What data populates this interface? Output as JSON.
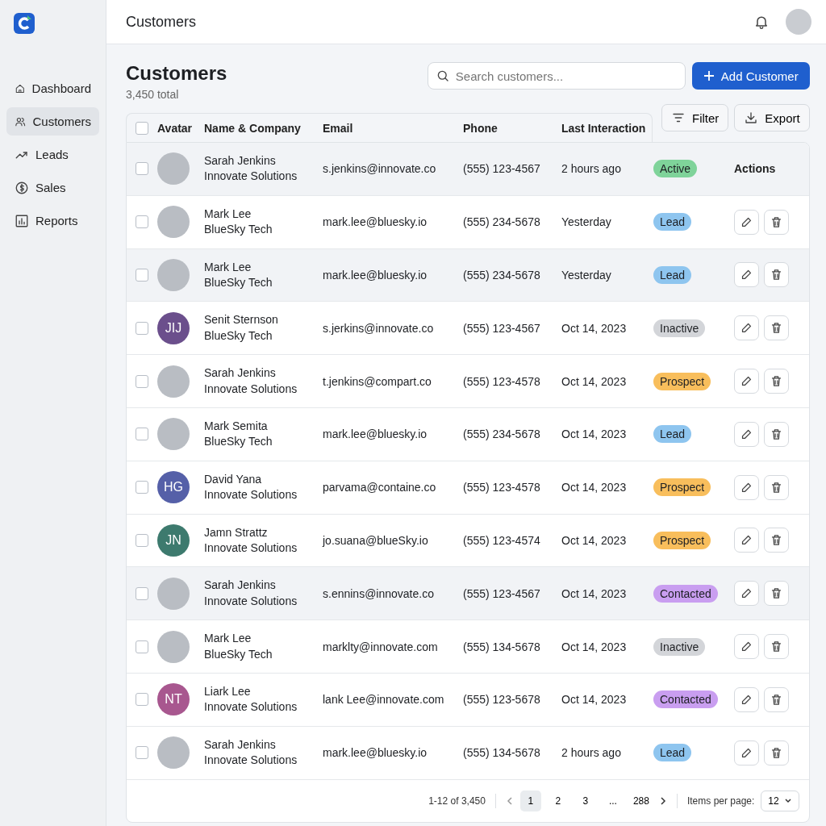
{
  "sidebar": {
    "items": [
      {
        "label": "Dashboard",
        "kind": "home",
        "selected": false
      },
      {
        "label": "Customers",
        "kind": "users",
        "selected": true
      },
      {
        "label": "Leads",
        "kind": "trend",
        "selected": false
      },
      {
        "label": "Sales",
        "kind": "dollar",
        "selected": false
      },
      {
        "label": "Reports",
        "kind": "chart",
        "selected": false
      }
    ]
  },
  "header": {
    "title": "Customers"
  },
  "page": {
    "title": "Customers",
    "subtitle": "3,450 total"
  },
  "search": {
    "placeholder": "Search customers..."
  },
  "add_button": "Add Customer",
  "filter_button": "Filter",
  "export_button": "Export",
  "table": {
    "select_all_checked": false,
    "columns": [
      "Avatar",
      "Name & Company",
      "Email",
      "Phone",
      "Last Interaction"
    ],
    "rows": [
      {
        "avatar": {
          "kind": "photo"
        },
        "name": "Sarah Jenkins",
        "company": "Innovate Solutions",
        "email": "s.jenkins@innovate.co",
        "phone": "(555) 123-4567",
        "last": "2 hours ago",
        "status": {
          "label": "Active",
          "color": "#7fd39a"
        },
        "actions_label": "Actions",
        "highlighted": true,
        "checked": false
      },
      {
        "avatar": {
          "kind": "photo"
        },
        "name": "Mark Lee",
        "company": "BlueSky Tech",
        "email": "mark.lee@bluesky.io",
        "phone": "(555) 234-5678",
        "last": "Yesterday",
        "status": {
          "label": "Lead",
          "color": "#8ec5ef"
        },
        "highlighted": false,
        "checked": false
      },
      {
        "avatar": {
          "kind": "photo"
        },
        "name": "Mark Lee",
        "company": "BlueSky Tech",
        "email": "mark.lee@bluesky.io",
        "phone": "(555) 234-5678",
        "last": "Yesterday",
        "status": {
          "label": "Lead",
          "color": "#8ec5ef"
        },
        "highlighted": true,
        "checked": false
      },
      {
        "avatar": {
          "kind": "initials",
          "initials": "JIJ",
          "color": "#6b4f8c"
        },
        "name": "Senit Sternson",
        "company": "BlueSky Tech",
        "email": "s.jerkins@innovate.co",
        "phone": "(555) 123-4567",
        "last": "Oct 14, 2023",
        "status": {
          "label": "Inactive",
          "color": "#d3d5d9"
        },
        "highlighted": false,
        "checked": false
      },
      {
        "avatar": {
          "kind": "photo"
        },
        "name": "Sarah Jenkins",
        "company": "Innovate Solutions",
        "email": "t.jenkins@compart.co",
        "phone": "(555) 123-4578",
        "last": "Oct 14, 2023",
        "status": {
          "label": "Prospect",
          "color": "#f8be5c"
        },
        "highlighted": false,
        "checked": false
      },
      {
        "avatar": {
          "kind": "photo"
        },
        "name": "Mark Semita",
        "company": "BlueSky Tech",
        "email": "mark.lee@bluesky.io",
        "phone": "(555) 234-5678",
        "last": "Oct 14, 2023",
        "status": {
          "label": "Lead",
          "color": "#8ec5ef"
        },
        "highlighted": false,
        "checked": false
      },
      {
        "avatar": {
          "kind": "initials",
          "initials": "HG",
          "color": "#5560a8"
        },
        "name": "David Yana",
        "company": "Innovate Solutions",
        "email": "parvama@containe.co",
        "phone": "(555) 123-4578",
        "last": "Oct 14, 2023",
        "status": {
          "label": "Prospect",
          "color": "#f8be5c"
        },
        "highlighted": false,
        "checked": false
      },
      {
        "avatar": {
          "kind": "initials",
          "initials": "JN",
          "color": "#3d7a6e"
        },
        "name": "Jamn Strattz",
        "company": "Innovate Solutions",
        "email": "jo.suana@blueSky.io",
        "phone": "(555) 123-4574",
        "last": "Oct 14, 2023",
        "status": {
          "label": "Prospect",
          "color": "#f8be5c"
        },
        "highlighted": false,
        "checked": false
      },
      {
        "avatar": {
          "kind": "photo"
        },
        "name": "Sarah Jenkins",
        "company": "Innovate Solutions",
        "email": "s.ennins@innovate.co",
        "phone": "(555) 123-4567",
        "last": "Oct 14, 2023",
        "status": {
          "label": "Contacted",
          "color": "#c99ef0"
        },
        "highlighted": true,
        "checked": false
      },
      {
        "avatar": {
          "kind": "photo"
        },
        "name": "Mark Lee",
        "company": "BlueSky Tech",
        "email": "marklty@innovate.com",
        "phone": "(555) 134-5678",
        "last": "Oct 14, 2023",
        "status": {
          "label": "Inactive",
          "color": "#d3d5d9"
        },
        "highlighted": false,
        "checked": false
      },
      {
        "avatar": {
          "kind": "initials",
          "initials": "NT",
          "color": "#a8578f"
        },
        "name": "Liark Lee",
        "company": "Innovate Solutions",
        "email": "lank Lee@innovate.com",
        "phone": "(555) 123-5678",
        "last": "Oct 14, 2023",
        "status": {
          "label": "Contacted",
          "color": "#c99ef0"
        },
        "highlighted": false,
        "checked": false
      },
      {
        "avatar": {
          "kind": "photo"
        },
        "name": "Sarah Jenkins",
        "company": "Innovate Solutions",
        "email": "mark.lee@bluesky.io",
        "phone": "(555) 134-5678",
        "last": "2 hours ago",
        "status": {
          "label": "Lead",
          "color": "#8ec5ef"
        },
        "highlighted": false,
        "checked": false
      }
    ]
  },
  "pagination": {
    "range": "1-12 of 3,450",
    "pages": [
      {
        "label": "1",
        "selected": true
      },
      {
        "label": "2",
        "selected": false
      },
      {
        "label": "3",
        "selected": false
      },
      {
        "label": "...",
        "selected": false
      },
      {
        "label": "288",
        "selected": false
      }
    ],
    "items_per_page_label": "Items per page:",
    "items_per_page": "12"
  }
}
